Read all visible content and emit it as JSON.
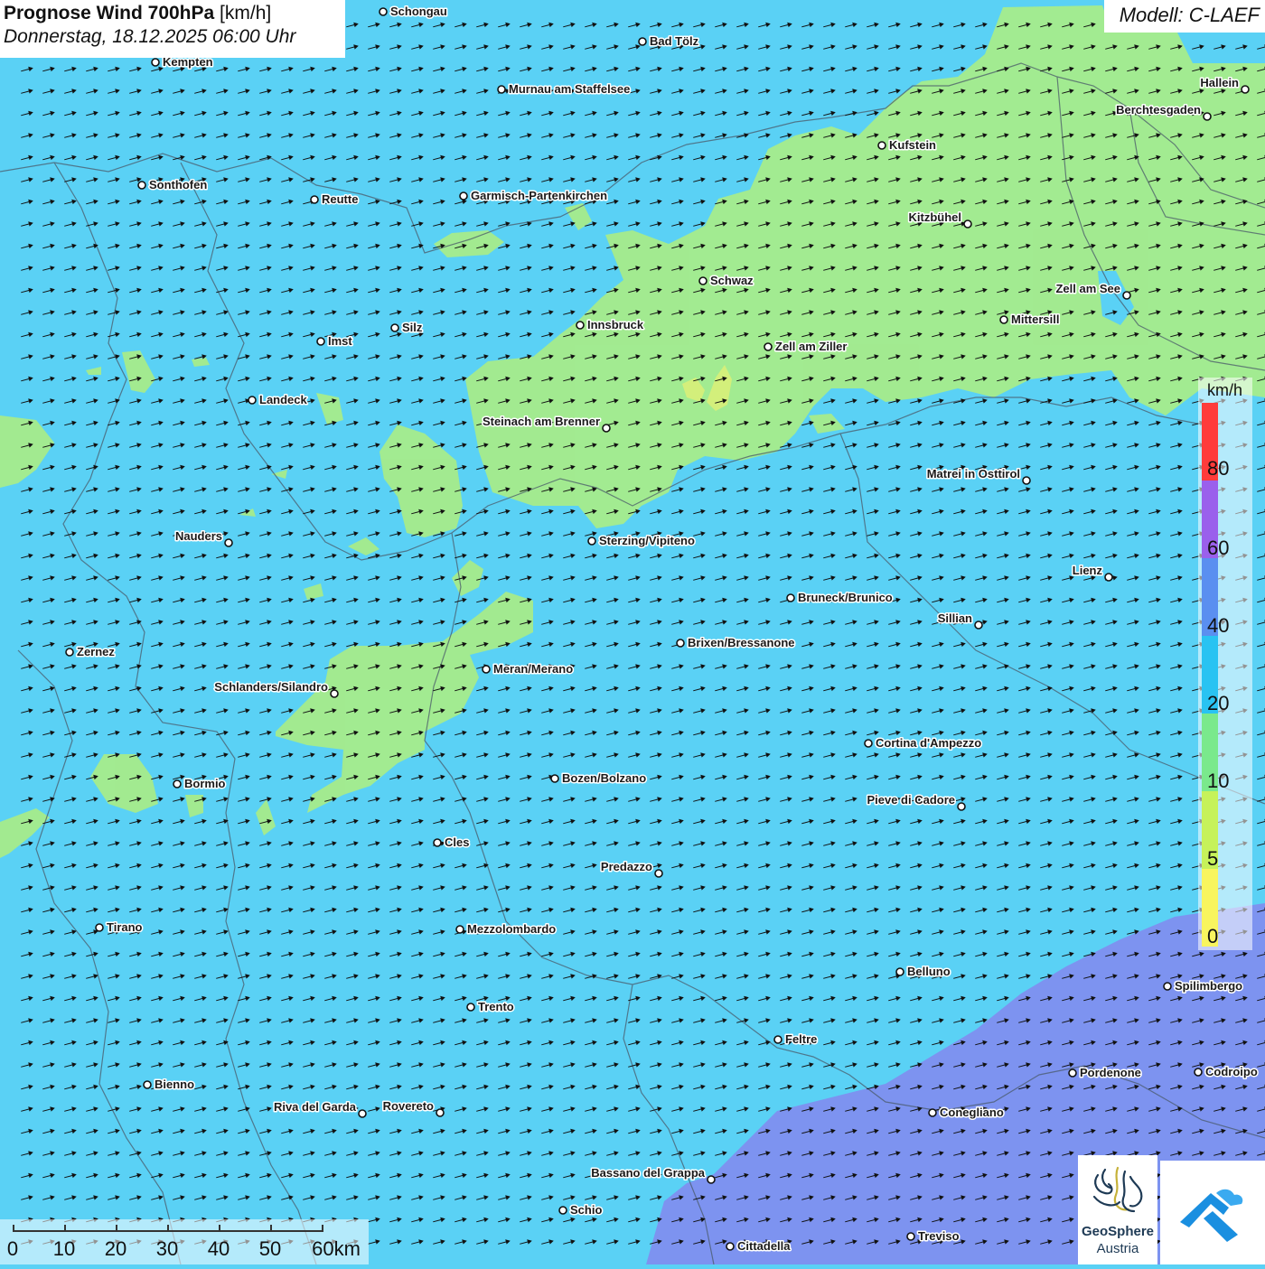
{
  "title": {
    "main": "Prognose Wind 700hPa",
    "unit": "[km/h]",
    "datetime": "Donnerstag, 18.12.2025 06:00 Uhr"
  },
  "model": "Modell: C-LAEF",
  "colors": {
    "background_wind_10_20": "#5ad1f5",
    "wind_5_10": "#a6ec8b",
    "wind_20_40": "#7d93f0",
    "wind_0_5": "#f0f57a"
  },
  "legend": {
    "unit": "km/h",
    "ticks": [
      "80",
      "60",
      "40",
      "20",
      "10",
      "5",
      "0"
    ],
    "colors": [
      "#ff3b3b",
      "#9a60ec",
      "#5a8ff0",
      "#29c3f2",
      "#7ae98c",
      "#c6f25a",
      "#f8f55e"
    ]
  },
  "cities": [
    {
      "name": "Schongau",
      "side": "right"
    },
    {
      "name": "Bad Tölz",
      "side": "right"
    },
    {
      "name": "Kempten",
      "side": "right"
    },
    {
      "name": "Murnau am Staffelsee",
      "side": "right"
    },
    {
      "name": "Hallein",
      "side": "left"
    },
    {
      "name": "Berchtesgaden",
      "side": "left"
    },
    {
      "name": "Kufstein",
      "side": "right"
    },
    {
      "name": "Sonthofen",
      "side": "right"
    },
    {
      "name": "Reutte",
      "side": "right"
    },
    {
      "name": "Garmisch-Partenkirchen",
      "side": "right"
    },
    {
      "name": "Kitzbühel",
      "side": "left"
    },
    {
      "name": "Schwaz",
      "side": "right"
    },
    {
      "name": "Zell am See",
      "side": "left"
    },
    {
      "name": "Mittersill",
      "side": "right"
    },
    {
      "name": "Innsbruck",
      "side": "right"
    },
    {
      "name": "Silz",
      "side": "right"
    },
    {
      "name": "Imst",
      "side": "right"
    },
    {
      "name": "Zell am Ziller",
      "side": "right"
    },
    {
      "name": "Landeck",
      "side": "right"
    },
    {
      "name": "Steinach am Brenner",
      "side": "left"
    },
    {
      "name": "Matrei in Osttirol",
      "side": "left"
    },
    {
      "name": "Nauders",
      "side": "left"
    },
    {
      "name": "Sterzing/Vipiteno",
      "side": "right"
    },
    {
      "name": "Lienz",
      "side": "left"
    },
    {
      "name": "Bruneck/Brunico",
      "side": "right"
    },
    {
      "name": "Sillian",
      "side": "left"
    },
    {
      "name": "Brixen/Bressanone",
      "side": "right"
    },
    {
      "name": "Zernez",
      "side": "right"
    },
    {
      "name": "Meran/Merano",
      "side": "right"
    },
    {
      "name": "Schlanders/Silandro",
      "side": "left"
    },
    {
      "name": "Cortina d'Ampezzo",
      "side": "right"
    },
    {
      "name": "Bozen/Bolzano",
      "side": "right"
    },
    {
      "name": "Bormio",
      "side": "right"
    },
    {
      "name": "Pieve di Cadore",
      "side": "left"
    },
    {
      "name": "Cles",
      "side": "right"
    },
    {
      "name": "Predazzo",
      "side": "left"
    },
    {
      "name": "Tirano",
      "side": "right"
    },
    {
      "name": "Mezzolombardo",
      "side": "right"
    },
    {
      "name": "Belluno",
      "side": "right"
    },
    {
      "name": "Spilimbergo",
      "side": "right"
    },
    {
      "name": "Trento",
      "side": "right"
    },
    {
      "name": "Feltre",
      "side": "right"
    },
    {
      "name": "Pordenone",
      "side": "right"
    },
    {
      "name": "Codroipo",
      "side": "right"
    },
    {
      "name": "Bienno",
      "side": "right"
    },
    {
      "name": "Riva del Garda",
      "side": "left"
    },
    {
      "name": "Rovereto",
      "side": "left"
    },
    {
      "name": "Conegliano",
      "side": "right"
    },
    {
      "name": "Bassano del Grappa",
      "side": "left"
    },
    {
      "name": "Schio",
      "side": "right"
    },
    {
      "name": "Treviso",
      "side": "right"
    },
    {
      "name": "Cittadella",
      "side": "right"
    }
  ],
  "scale": {
    "ticks": [
      "0",
      "10",
      "20",
      "30",
      "40",
      "50",
      "60km"
    ]
  },
  "logos": {
    "geosphere_name": "GeoSphere",
    "geosphere_sub": "Austria"
  }
}
